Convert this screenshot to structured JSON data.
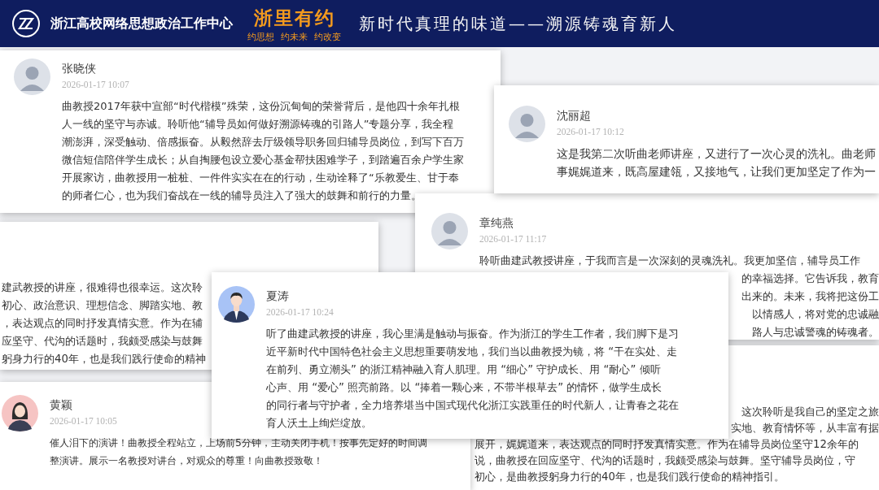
{
  "header": {
    "title": "浙江高校网络思想政治工作中心",
    "brand": "浙里有约",
    "brand_tagline": [
      "约思想",
      "约未来",
      "约改变"
    ],
    "slogan": "新时代真理的味道——溯源铸魂育新人"
  },
  "comments": [
    {
      "name": "张晓侠",
      "date": "2026-01-17 10:07",
      "kind": "photo",
      "lines": [
        "曲教授2017年获中宣部“时代楷模”殊荣，这份沉甸甸的荣誉背后，是他四十余年扎根",
        "人一线的坚守与赤诚。聆听他“辅导员如何做好溯源铸魂的引路人”专题分享，我全程",
        "潮澎湃，深受触动、倍感振奋。从毅然辞去厅级领导职务回归辅导员岗位，到写下百万",
        "微信短信陪伴学生成长；从自掏腰包设立爱心基金帮扶困难学子，到踏遍百余户学生家",
        "开展家访，曲教授用一桩桩、一件件实实在在的行动，生动诠释了“乐教爱生、甘于奉",
        "的师者仁心，也为我们奋战在一线的辅导员注入了强大的鼓舞和前行的力量。"
      ]
    },
    {
      "name": "沈丽超",
      "date": "2026-01-17 10:12",
      "kind": "photo",
      "lines": [
        "这是我第二次听曲老师讲座，又进行了一次心灵的洗礼。曲老师",
        "事娓娓道来，既高屋建瓴，又接地气，让我们更加坚定了作为一"
      ]
    },
    {
      "lines": [
        "建武教授的讲座，很难得也很幸运。这次聆",
        "初心、政治意识、理想信念、脚踏实地、教",
        "，表达观点的同时抒发真情实意。作为在辅",
        "应坚守、代沟的话题时，我颇受感染与鼓舞",
        "躬身力行的40年，也是我们践行使命的精神"
      ]
    },
    {
      "name": "章纯燕",
      "date": "2026-01-17 11:17",
      "kind": "photo",
      "lines": [
        "聆听曲建武教授讲座，于我而言是一次深刻的灵魂洗礼。我更加坚信，辅导员工作",
        "的幸福选择。它告诉我，教育",
        "出来的。未来，我将把这份工",
        "以情感人，将对党的忠诚融",
        "路人与忠诚警魂的铸魂者。"
      ]
    },
    {
      "name": "夏涛",
      "date": "2026-01-17 10:24",
      "kind": "cartoon-man",
      "lines": [
        "听了曲建武教授的讲座，我心里满是触动与振奋。作为浙江的学生工作者，我们脚下是习",
        "近平新时代中国特色社会主义思想重要萌发地，我们当以曲教授为镜，将 “干在实处、走",
        "在前列、勇立潮头” 的浙江精神融入育人肌理。用 “细心” 守护成长、用 “耐心” 倾听",
        "心声、用 “爱心” 照亮前路。以 “捧着一颗心来，不带半根草去” 的情怀，做学生成长",
        "的同行者与守护者，全力培养堪当中国式现代化浙江实践重任的时代新人，让青春之花在",
        "育人沃土上绚烂绽放。"
      ]
    },
    {
      "name": "黄颖",
      "date": "2026-01-17 10:05",
      "kind": "cartoon-woman",
      "lines": [
        "催人泪下的演讲！曲教授全程站立，上场前5分钟，主动关闭手机！按事先定好的时间调",
        "整演讲。展示一名教授对讲台，对观众的尊重！向曲教授致敬！"
      ]
    },
    {
      "lines": [
        "这次聆听是我自己的坚定之旅",
        "实地、教育情怀等，从丰富有据",
        "展开，娓娓道来，表达观点的同时抒发真情实意。作为在辅导员岗位坚守12余年的",
        "说，曲教授在回应坚守、代沟的话题时，我颇受感染与鼓舞。坚守辅导员岗位，守",
        "初心，是曲教授躬身力行的40年，也是我们践行使命的精神指引。"
      ]
    }
  ]
}
